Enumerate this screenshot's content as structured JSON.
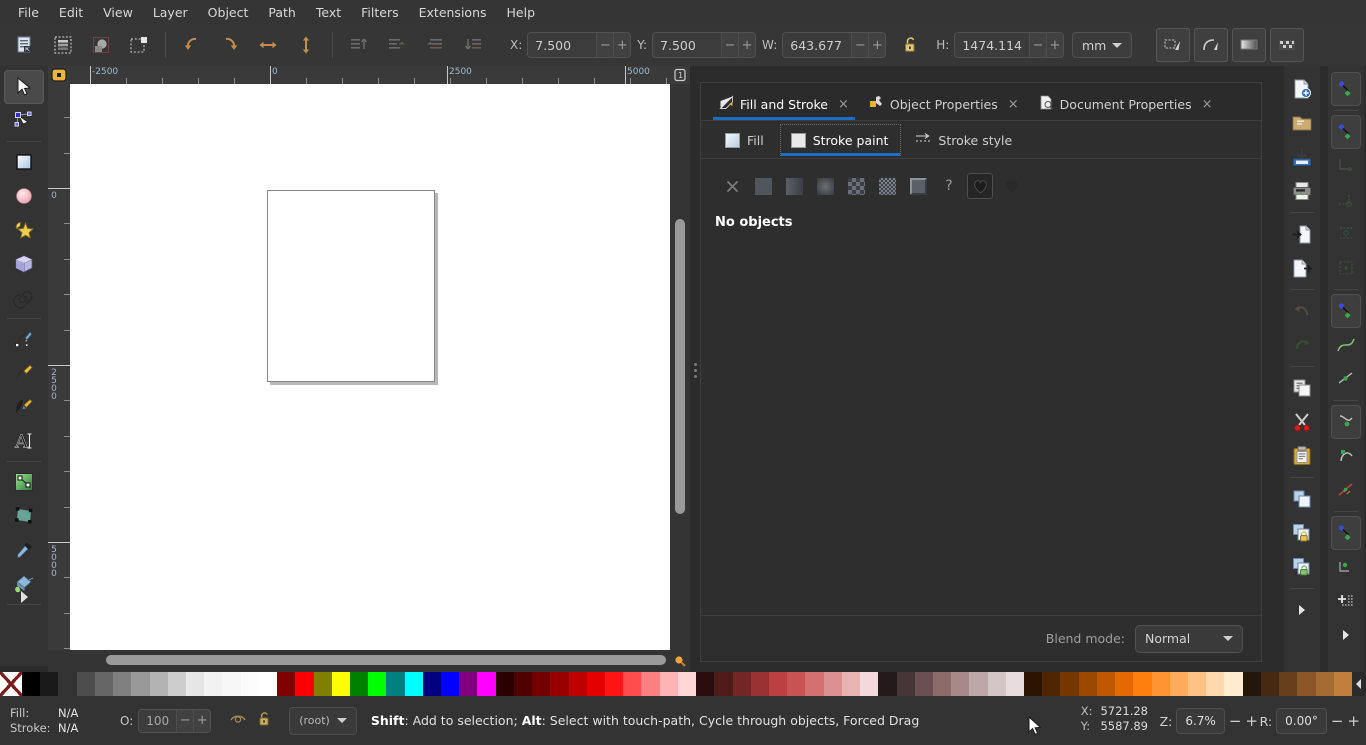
{
  "app": {
    "title": "Inkscape"
  },
  "menubar": {
    "items": [
      {
        "label": "File"
      },
      {
        "label": "Edit"
      },
      {
        "label": "View"
      },
      {
        "label": "Layer"
      },
      {
        "label": "Object"
      },
      {
        "label": "Path"
      },
      {
        "label": "Text"
      },
      {
        "label": "Filters"
      },
      {
        "label": "Extensions"
      },
      {
        "label": "Help"
      }
    ]
  },
  "command_toolbar": {
    "buttons": [
      {
        "name": "select-all-icon",
        "enabled": true
      },
      {
        "name": "select-all-in-layers-icon",
        "enabled": true
      },
      {
        "name": "deselect-icon",
        "enabled": true
      },
      {
        "name": "select-same-icon",
        "enabled": true
      },
      {
        "name": "rotate-ccw-icon",
        "enabled": true
      },
      {
        "name": "rotate-cw-icon",
        "enabled": true
      },
      {
        "name": "flip-horizontal-icon",
        "enabled": true
      },
      {
        "name": "flip-vertical-icon",
        "enabled": true
      },
      {
        "name": "raise-to-top-icon",
        "enabled": false
      },
      {
        "name": "raise-icon",
        "enabled": false
      },
      {
        "name": "lower-icon",
        "enabled": false
      },
      {
        "name": "lower-to-bottom-icon",
        "enabled": false
      }
    ],
    "fields": [
      {
        "key": "X",
        "label": "X:",
        "value": "7.500"
      },
      {
        "key": "Y",
        "label": "Y:",
        "value": "7.500"
      },
      {
        "key": "W",
        "label": "W:",
        "value": "643.677"
      },
      {
        "key": "H",
        "label": "H:",
        "value": "1474.114"
      }
    ],
    "lock_ratio": {
      "name": "lock-ratio-icon",
      "locked": false
    },
    "units": {
      "value": "mm"
    },
    "right_buttons": [
      {
        "name": "affect-stroke-width-icon"
      },
      {
        "name": "affect-rounded-corners-icon"
      },
      {
        "name": "affect-gradients-icon"
      },
      {
        "name": "affect-patterns-icon"
      }
    ]
  },
  "toolbox": {
    "tools": [
      {
        "name": "selector-tool",
        "icon": "arrow-pointer-icon",
        "active": true
      },
      {
        "name": "node-tool",
        "icon": "node-editor-icon",
        "active": false
      },
      {
        "name": "rectangle-tool",
        "icon": "rectangle-icon",
        "active": false
      },
      {
        "name": "ellipse-tool",
        "icon": "ellipse-icon",
        "active": false
      },
      {
        "name": "star-tool",
        "icon": "star-icon",
        "active": false
      },
      {
        "name": "box3d-tool",
        "icon": "cube-icon",
        "active": false
      },
      {
        "name": "spiral-tool",
        "icon": "spiral-icon",
        "active": false
      },
      {
        "name": "pen-tool",
        "icon": "bezier-pen-icon",
        "active": false
      },
      {
        "name": "pencil-tool",
        "icon": "pencil-icon",
        "active": false
      },
      {
        "name": "calligraphy-tool",
        "icon": "calligraphy-pen-icon",
        "active": false
      },
      {
        "name": "text-tool",
        "icon": "text-a-icon",
        "active": false
      },
      {
        "name": "gradient-tool",
        "icon": "gradient-icon",
        "active": false
      },
      {
        "name": "mesh-tool",
        "icon": "mesh-gradient-icon",
        "active": false
      },
      {
        "name": "dropper-tool",
        "icon": "eyedropper-icon",
        "active": false
      },
      {
        "name": "paintbucket-tool",
        "icon": "paint-bucket-icon",
        "active": false
      }
    ],
    "expander": {
      "name": "toolbox-expander-icon"
    }
  },
  "rulers": {
    "unit_badge": "1",
    "horizontal": {
      "labels": [
        "-2500",
        "0",
        "2500",
        "5000"
      ]
    },
    "vertical": {
      "labels": [
        "0",
        "2500",
        "5000"
      ]
    }
  },
  "canvas": {
    "page_visible": true
  },
  "dock": {
    "tabs": [
      {
        "label": "Fill and Stroke",
        "icon": "fill-stroke-icon",
        "active": true,
        "close": "×"
      },
      {
        "label": "Object Properties",
        "icon": "object-properties-icon",
        "active": false,
        "close": "×"
      },
      {
        "label": "Document Properties",
        "icon": "document-properties-icon",
        "active": false,
        "close": "×"
      }
    ],
    "subtabs": [
      {
        "label": "Fill",
        "icon": "fill-swatch-icon",
        "active": false
      },
      {
        "label": "Stroke paint",
        "icon": "stroke-swatch-icon",
        "active": true
      },
      {
        "label": "Stroke style",
        "icon": "stroke-style-icon",
        "active": false
      }
    ],
    "paint_buttons": [
      {
        "name": "no-paint-button",
        "kind": "x",
        "selected": false
      },
      {
        "name": "flat-color-button",
        "kind": "flat",
        "selected": false
      },
      {
        "name": "linear-gradient-button",
        "kind": "linear",
        "selected": false
      },
      {
        "name": "radial-gradient-button",
        "kind": "radial",
        "selected": false
      },
      {
        "name": "pattern-button",
        "kind": "pattern",
        "selected": false
      },
      {
        "name": "swatch-button",
        "kind": "swatch",
        "selected": false
      },
      {
        "name": "mesh-gradient-button",
        "kind": "mesh",
        "selected": false
      },
      {
        "name": "unknown-paint-button",
        "kind": "question",
        "label": "?",
        "selected": false
      },
      {
        "name": "flat-blur-button",
        "kind": "heart-outline",
        "selected": true
      },
      {
        "name": "pattern-blur-button",
        "kind": "heart-solid",
        "selected": false
      }
    ],
    "empty_message": "No objects",
    "blend_mode": {
      "label": "Blend mode:",
      "value": "Normal"
    },
    "footer_arrows": [
      {
        "name": "dock-collapse-left-icon"
      },
      {
        "name": "dock-collapse-right-icon"
      }
    ]
  },
  "command_strip": {
    "buttons": [
      {
        "name": "new-document-icon",
        "enabled": true
      },
      {
        "name": "open-document-icon",
        "enabled": true
      },
      {
        "name": "save-document-icon",
        "enabled": true
      },
      {
        "name": "print-document-icon",
        "enabled": true
      },
      {
        "name": "import-icon",
        "enabled": true
      },
      {
        "name": "export-icon",
        "enabled": true
      },
      {
        "name": "undo-icon",
        "enabled": false
      },
      {
        "name": "redo-icon",
        "enabled": false
      },
      {
        "name": "copy-icon",
        "enabled": true
      },
      {
        "name": "cut-icon",
        "enabled": true
      },
      {
        "name": "paste-icon",
        "enabled": true
      },
      {
        "name": "duplicate-icon",
        "enabled": true
      },
      {
        "name": "group-icon",
        "enabled": true
      },
      {
        "name": "ungroup-icon",
        "enabled": true
      },
      {
        "name": "command-strip-expander-icon",
        "enabled": true
      }
    ]
  },
  "snap_strip": {
    "buttons": [
      {
        "name": "enable-snapping-toggle",
        "state": "on"
      },
      {
        "name": "snap-bounding-box-toggle",
        "state": "on"
      },
      {
        "name": "snap-bbox-edge-toggle",
        "state": "dim"
      },
      {
        "name": "snap-bbox-corner-toggle",
        "state": "dim"
      },
      {
        "name": "snap-bbox-edge-midpoint-toggle",
        "state": "dim"
      },
      {
        "name": "snap-bbox-center-toggle",
        "state": "dim"
      },
      {
        "name": "snap-nodes-toggle",
        "state": "on"
      },
      {
        "name": "snap-path-toggle",
        "state": "normal"
      },
      {
        "name": "snap-path-intersection-toggle",
        "state": "normal"
      },
      {
        "name": "snap-cusp-node-toggle",
        "state": "on"
      },
      {
        "name": "snap-smooth-node-toggle",
        "state": "normal"
      },
      {
        "name": "snap-midpoint-toggle",
        "state": "normal"
      },
      {
        "name": "snap-object-center-toggle",
        "state": "on"
      },
      {
        "name": "snap-page-border-toggle",
        "state": "normal"
      },
      {
        "name": "snap-grid-toggle",
        "state": "normal"
      },
      {
        "name": "snap-strip-expander-icon",
        "state": "normal"
      }
    ]
  },
  "palette": {
    "none_swatch": {
      "name": "palette-none-swatch"
    },
    "colors": [
      "#000000",
      "#1a1a1a",
      "#333333",
      "#4d4d4d",
      "#666666",
      "#808080",
      "#999999",
      "#b3b3b3",
      "#cccccc",
      "#e6e6e6",
      "#f2f2f2",
      "#f7f7f7",
      "#fcfcfc",
      "#ffffff",
      "#800000",
      "#ff0000",
      "#808000",
      "#ffff00",
      "#008000",
      "#00ff00",
      "#008080",
      "#00ffff",
      "#000080",
      "#0000ff",
      "#800080",
      "#ff00ff",
      "#2b0000",
      "#500000",
      "#750000",
      "#9a0000",
      "#bf0000",
      "#e40000",
      "#ff1414",
      "#ff4d4d",
      "#ff8080",
      "#ffb3b3",
      "#ffd6d6",
      "#2b0d0d",
      "#4f1a1a",
      "#742626",
      "#993333",
      "#bd4040",
      "#c95353",
      "#d47070",
      "#dd9090",
      "#e8b3b3",
      "#f3d9d9",
      "#231b1b",
      "#463636",
      "#6a5050",
      "#8d6b6b",
      "#a88989",
      "#bda7a7",
      "#d4c6c6",
      "#e6dede",
      "#2b1400",
      "#502500",
      "#753600",
      "#9a4700",
      "#bf5800",
      "#e46900",
      "#ff7f0e",
      "#ff9433",
      "#ffab5c",
      "#ffc285",
      "#ffd9ad",
      "#ffecd1",
      "#241608",
      "#452a11",
      "#66401c",
      "#8a5628",
      "#a66a33",
      "#c07f3d"
    ]
  },
  "status_bar": {
    "fill": {
      "label": "Fill:",
      "value": "N/A"
    },
    "stroke": {
      "label": "Stroke:",
      "value": "N/A"
    },
    "opacity": {
      "label": "O:",
      "value": "100"
    },
    "visibility_icon": {
      "name": "layer-visible-icon"
    },
    "lock_icon": {
      "name": "layer-lock-icon"
    },
    "layer": {
      "value": "(root)"
    },
    "message_prefix1": "Shift",
    "message_part1": ": Add to selection; ",
    "message_prefix2": "Alt",
    "message_part2": ": Select with touch-path, Cycle through objects, Forced Drag",
    "pointer": {
      "x_label": "X:",
      "x_value": "5721.28",
      "y_label": "Y:",
      "y_value": "5587.89"
    },
    "zoom": {
      "label": "Z:",
      "value": "6.7%"
    },
    "rotation": {
      "label": "R:",
      "value": "0.00°"
    }
  },
  "colors": {
    "accent": "#1a6fc4",
    "chrome_bg": "#353535",
    "panel_bg": "#2e2e2e",
    "canvas_bg": "#ffffff"
  }
}
